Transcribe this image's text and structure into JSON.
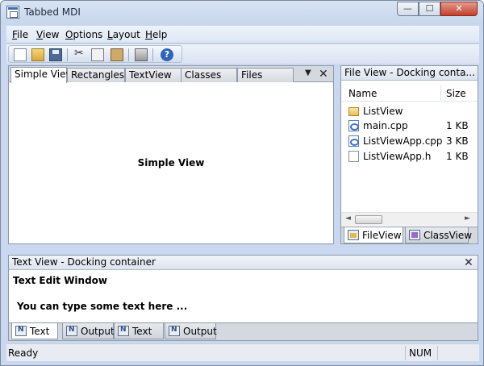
{
  "window": {
    "title": "Tabbed MDI"
  },
  "caption_buttons": {
    "minimize": "—",
    "maximize": "☐",
    "close": "✕"
  },
  "menu": [
    {
      "label": "File",
      "accel": "F",
      "rest": "ile"
    },
    {
      "label": "View",
      "accel": "V",
      "rest": "iew"
    },
    {
      "label": "Options",
      "accel": "O",
      "rest": "ptions"
    },
    {
      "label": "Layout",
      "accel": "L",
      "rest": "ayout"
    },
    {
      "label": "Help",
      "accel": "H",
      "rest": "elp"
    }
  ],
  "toolbar": {
    "icons": [
      "new-file-icon",
      "open-folder-icon",
      "save-icon",
      "cut-icon",
      "copy-icon",
      "paste-icon",
      "print-icon",
      "help-icon"
    ]
  },
  "tabs": {
    "items": [
      "Simple View",
      "Rectangles",
      "TextView",
      "Classes",
      "Files"
    ],
    "active_index": 0,
    "dropdown_glyph": "▼",
    "close_glyph": "✕"
  },
  "simple_view": {
    "label": "Simple View"
  },
  "file_view": {
    "title": "File View - Docking conta...",
    "close_glyph": "✕",
    "columns": [
      "Name",
      "Size"
    ],
    "rows": [
      {
        "icon": "folder-icon",
        "name": "ListView",
        "size": ""
      },
      {
        "icon": "cpp-file-icon",
        "name": "main.cpp",
        "size": "1 KB"
      },
      {
        "icon": "cpp-file-icon",
        "name": "ListViewApp.cpp",
        "size": "3 KB"
      },
      {
        "icon": "header-file-icon",
        "name": "ListViewApp.h",
        "size": "1 KB"
      }
    ],
    "scroll_left": "◄",
    "scroll_right": "►",
    "tabs": [
      "FileView",
      "ClassView"
    ],
    "active_tab_index": 0
  },
  "text_view": {
    "title": "Text View - Docking container",
    "close_glyph": "✕",
    "heading": "Text Edit Window",
    "body": "You can type some text here ...",
    "tabs": [
      "Text",
      "Output",
      "Text",
      "Output"
    ],
    "active_tab_index": 0
  },
  "status": {
    "text": "Ready",
    "num": "NUM"
  }
}
